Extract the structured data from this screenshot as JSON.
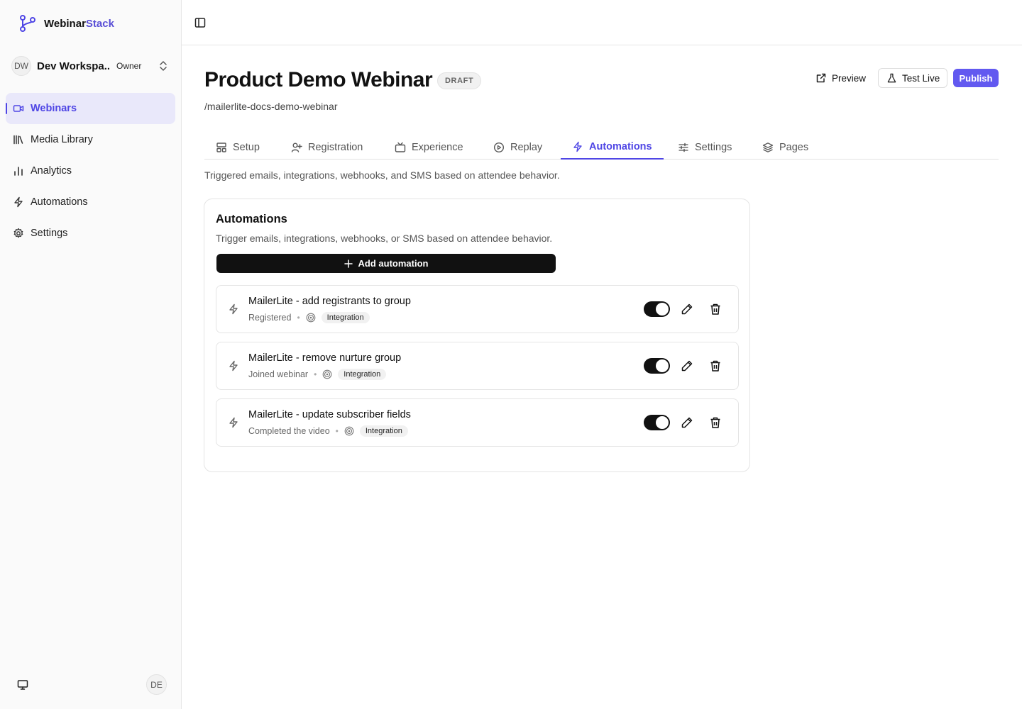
{
  "brand": {
    "name_part1": "Webinar",
    "name_part2": "Stack"
  },
  "workspace": {
    "initials": "DW",
    "name": "Dev Workspa...",
    "role": "Owner"
  },
  "sidebar": {
    "items": [
      {
        "label": "Webinars",
        "icon": "video-icon",
        "active": true
      },
      {
        "label": "Media Library",
        "icon": "library-icon",
        "active": false
      },
      {
        "label": "Analytics",
        "icon": "bar-chart-icon",
        "active": false
      },
      {
        "label": "Automations",
        "icon": "bolt-icon",
        "active": false
      },
      {
        "label": "Settings",
        "icon": "gear-icon",
        "active": false
      }
    ],
    "user_initials": "DE"
  },
  "header": {
    "title": "Product Demo Webinar",
    "status": "DRAFT",
    "slug": "/mailerlite-docs-demo-webinar",
    "preview_label": "Preview",
    "test_live_label": "Test Live",
    "publish_label": "Publish"
  },
  "tabs": [
    {
      "label": "Setup",
      "icon": "layout-icon",
      "active": false
    },
    {
      "label": "Registration",
      "icon": "user-plus-icon",
      "active": false
    },
    {
      "label": "Experience",
      "icon": "tv-icon",
      "active": false
    },
    {
      "label": "Replay",
      "icon": "play-circle-icon",
      "active": false
    },
    {
      "label": "Automations",
      "icon": "bolt-icon",
      "active": true
    },
    {
      "label": "Settings",
      "icon": "sliders-icon",
      "active": false
    },
    {
      "label": "Pages",
      "icon": "layers-icon",
      "active": false
    }
  ],
  "tab_description": "Triggered emails, integrations, webhooks, and SMS based on attendee behavior.",
  "automations_card": {
    "title": "Automations",
    "subtitle": "Trigger emails, integrations, webhooks, or SMS based on attendee behavior.",
    "add_label": "Add automation",
    "items": [
      {
        "name": "MailerLite - add registrants to group",
        "trigger": "Registered",
        "type": "Integration",
        "enabled": true
      },
      {
        "name": "MailerLite - remove nurture group",
        "trigger": "Joined webinar",
        "type": "Integration",
        "enabled": true
      },
      {
        "name": "MailerLite - update subscriber fields",
        "trigger": "Completed the video",
        "type": "Integration",
        "enabled": true
      }
    ]
  },
  "colors": {
    "accent": "#4f46e5",
    "publish": "#6259f0",
    "active_nav_bg": "#e9e8fa"
  }
}
